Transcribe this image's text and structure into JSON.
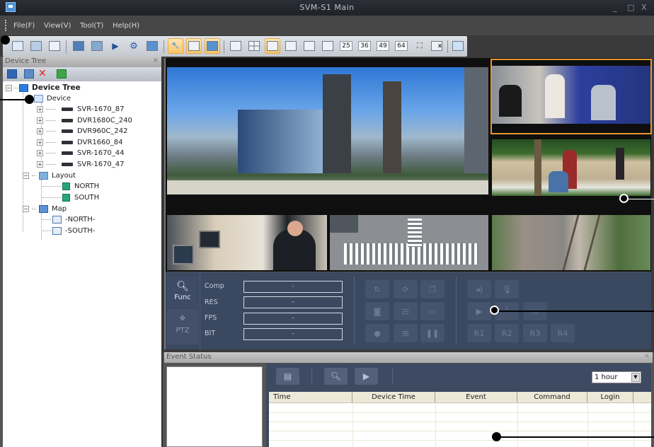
{
  "window": {
    "title": "SVM-S1 Main",
    "controls": {
      "minimize": "_",
      "maximize": "□",
      "close": "X"
    }
  },
  "menu": [
    "File(F)",
    "View(V)",
    "Tool(T)",
    "Help(H)"
  ],
  "toolbar": {
    "buttons": [
      {
        "icon": "add-device-icon"
      },
      {
        "icon": "device-list-icon"
      },
      {
        "icon": "log-icon"
      },
      {
        "icon": "device-settings-icon"
      },
      {
        "icon": "map-search-icon"
      },
      {
        "icon": "playback-icon"
      },
      {
        "icon": "settings-icon"
      },
      {
        "icon": "monitor-icon"
      },
      {
        "icon": "tool-icon",
        "active": true
      },
      {
        "icon": "layout-panel-icon",
        "active": true
      },
      {
        "icon": "multi-window-icon",
        "active": true
      },
      {
        "icon": "split-1-icon"
      },
      {
        "icon": "split-4-icon"
      },
      {
        "icon": "split-6-icon",
        "active": true
      },
      {
        "icon": "split-8-icon"
      },
      {
        "icon": "split-9-icon"
      },
      {
        "icon": "split-16-icon"
      }
    ],
    "split_numbers": [
      "25",
      "36",
      "49",
      "64"
    ],
    "extra": [
      "fullscreen-icon",
      "close-all-icon",
      "export-icon"
    ]
  },
  "device_tree": {
    "panel_title": "Device Tree",
    "root": "Device Tree",
    "device_group": "Device",
    "devices": [
      "SVR-1670_87",
      "DVR1680C_240",
      "DVR960C_242",
      "DVR1660_84",
      "SVR-1670_44",
      "SVR-1670_47"
    ],
    "layout_group": "Layout",
    "layouts": [
      "NORTH",
      "SOUTH"
    ],
    "map_group": "Map",
    "maps": [
      "-NORTH-",
      "-SOUTH-"
    ]
  },
  "control_panel": {
    "tabs": [
      {
        "label": "Func",
        "active": true
      },
      {
        "label": "PTZ",
        "active": false
      }
    ],
    "params": [
      {
        "label": "Comp",
        "value": "-"
      },
      {
        "label": "RES",
        "value": "-"
      },
      {
        "label": "FPS",
        "value": "-"
      },
      {
        "label": "BIT",
        "value": "-"
      }
    ],
    "relay_labels": [
      "R1",
      "R2",
      "R3",
      "R4"
    ]
  },
  "event_status": {
    "panel_title": "Event Status",
    "period": "1 hour",
    "columns": [
      "Time",
      "Device Time",
      "Event",
      "Command",
      "Login"
    ]
  },
  "colors": {
    "selected_tile": "#e8952b",
    "active_toolbar": "#f7c46a",
    "control_bg": "#3a4860"
  }
}
